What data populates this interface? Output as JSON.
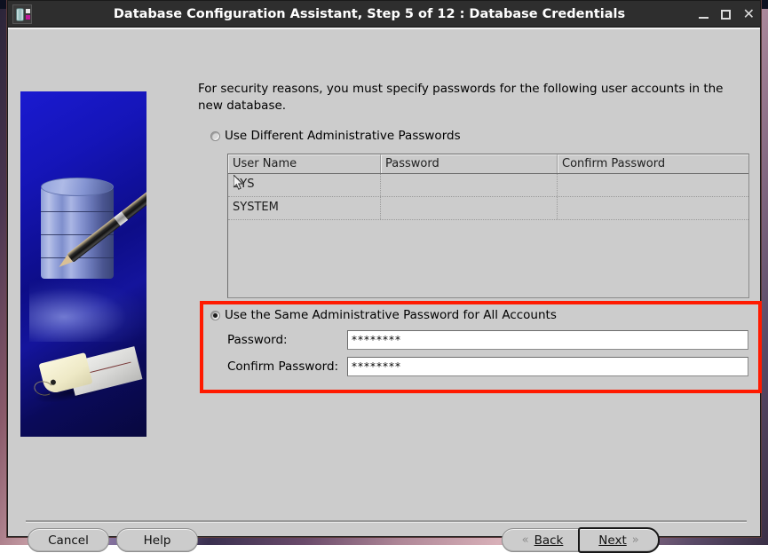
{
  "window": {
    "title": "Database Configuration Assistant, Step 5 of 12 : Database Credentials",
    "icon": "database-icon",
    "controls": {
      "minimize": "minimize-icon",
      "maximize": "maximize-icon",
      "close": "close-icon"
    }
  },
  "content": {
    "intro_text": "For security reasons, you must specify passwords for the following user accounts in the new database.",
    "option_different": {
      "label": "Use Different Administrative Passwords",
      "selected": false
    },
    "option_same": {
      "label": "Use the Same Administrative Password for All Accounts",
      "selected": true
    },
    "table": {
      "columns": [
        "User Name",
        "Password",
        "Confirm Password"
      ],
      "rows": [
        {
          "user_name": "SYS",
          "password": "",
          "confirm_password": ""
        },
        {
          "user_name": "SYSTEM",
          "password": "",
          "confirm_password": ""
        }
      ]
    },
    "fields": {
      "password_label": "Password:",
      "password_value": "********",
      "confirm_label": "Confirm Password:",
      "confirm_value": "********"
    },
    "highlight_color": "#ff1a00"
  },
  "footer": {
    "cancel_label": "Cancel",
    "help_label": "Help",
    "back_label": "Back",
    "back_chevron": "«",
    "next_label": "Next",
    "next_chevron": "»"
  },
  "colors": {
    "window_background": "#cccccc",
    "titlebar_background": "#2e2e2e",
    "titlebar_text": "#ffffff",
    "accent_highlight": "#ff1a00",
    "illustration_background": "#1414b0"
  }
}
